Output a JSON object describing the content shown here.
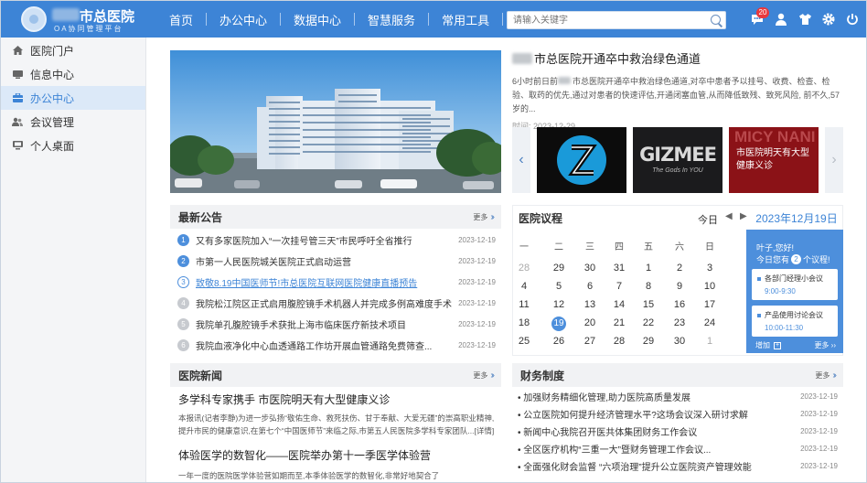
{
  "header": {
    "title": "市总医院",
    "subtitle": "OA协同管理平台",
    "nav": [
      "首页",
      "办公中心",
      "数据中心",
      "智慧服务",
      "常用工具"
    ],
    "nav_more": "•••",
    "search_placeholder": "请输入关键字",
    "badge_count": "20"
  },
  "sidebar": {
    "items": [
      {
        "label": "医院门户"
      },
      {
        "label": "信息中心"
      },
      {
        "label": "办公中心"
      },
      {
        "label": "会议管理"
      },
      {
        "label": "个人桌面"
      }
    ]
  },
  "headline": {
    "title": "市总医院开通卒中救治绿色通道",
    "body_a": "6小时前日前",
    "body_b": "市总医院开通卒中救治绿色通道,对卒中患者予以挂号、收费、检查、检验、取药的优先,通过对患者的快速评估,开通闭塞血管,从而降低致残、致死风险, 前不久,57岁的...",
    "time": "时间: 2023-12-29"
  },
  "carousel": {
    "prev": "‹",
    "next": "›",
    "tile3": "市医院明天有大型健康义诊",
    "tile2_big": "GIZMEE",
    "tile2_small": "The Gods In YOU",
    "tile3_bg": "MICY NANI"
  },
  "notices": {
    "title": "最新公告",
    "more": "更多",
    "items": [
      {
        "n": "1",
        "text": "又有多家医院加入“一次挂号管三天”市民呼吁全省推行",
        "date": "2023-12-19"
      },
      {
        "n": "2",
        "text": "市第一人民医院城关医院正式启动运营",
        "date": "2023-12-19"
      },
      {
        "n": "3",
        "text": "致敬8.19中国医师节!市总医院互联网医院健康直播预告",
        "date": "2023-12-19"
      },
      {
        "n": "4",
        "text": "我院松江院区正式启用腹腔镜手术机器人并完成多例高难度手术",
        "date": "2023-12-19"
      },
      {
        "n": "5",
        "text": "我院单孔腹腔镜手术获批上海市临床医疗新技术项目",
        "date": "2023-12-19"
      },
      {
        "n": "6",
        "text": "我院血液净化中心血透通路工作坊开展血管通路免费筛查...",
        "date": "2023-12-19"
      }
    ]
  },
  "calendar": {
    "title": "医院议程",
    "today": "今日",
    "date": "2023年12月19日",
    "weekdays": [
      "一",
      "二",
      "三",
      "四",
      "五",
      "六",
      "日"
    ],
    "rows": [
      [
        "28",
        "29",
        "30",
        "31",
        "1",
        "2",
        "3"
      ],
      [
        "4",
        "5",
        "6",
        "7",
        "8",
        "9",
        "10"
      ],
      [
        "11",
        "12",
        "13",
        "14",
        "15",
        "16",
        "17"
      ],
      [
        "18",
        "19",
        "20",
        "21",
        "22",
        "23",
        "24"
      ],
      [
        "25",
        "26",
        "27",
        "28",
        "29",
        "30",
        "1"
      ]
    ],
    "greeting": "叶子,您好!",
    "count_pre": "今日您有",
    "count": "2",
    "count_post": "个议程!",
    "events": [
      {
        "title": "各部门经理小会议",
        "time": "9:00-9:30"
      },
      {
        "title": "产品使用讨论会议",
        "time": "10:00-11:30"
      }
    ],
    "add": "增加",
    "more": "更多"
  },
  "news": {
    "title": "医院新闻",
    "more": "更多",
    "items": [
      {
        "title": "多学科专家携手 市医院明天有大型健康义诊",
        "body": "本报讯(记者李静)为进一步弘扬“敬佑生命、救死扶伤、甘于奉献、大爱无疆”的崇高职业精神,提升市民的健康意识,在第七个“中国医师节”来临之际,市第五人民医院多学科专家团队...[详情]"
      },
      {
        "title": "体验医学的数智化——医院举办第十一季医学体验营",
        "body": "一年一度的医院医学体验营如期而至,本季体验医学的数智化,非常好地契合了"
      }
    ]
  },
  "finance": {
    "title": "财务制度",
    "more": "更多",
    "items": [
      {
        "text": "• 加强财务精细化管理,助力医院高质量发展",
        "date": "2023-12-19"
      },
      {
        "text": "• 公立医院如何提升经济管理水平?这场会议深入研讨求解",
        "date": "2023-12-19"
      },
      {
        "text": "• 新闻中心我院召开医共体集团财务工作会议",
        "date": "2023-12-19"
      },
      {
        "text": "• 全区医疗机构“三重一大”暨财务管理工作会议...",
        "date": "2023-12-19"
      },
      {
        "text": "• 全面强化财会监督 “六项治理”提升公立医院资产管理效能",
        "date": "2023-12-19"
      }
    ]
  },
  "colors": {
    "primary": "#3d84d6",
    "accent": "#4d8fdc",
    "badge": "#e8383d"
  }
}
